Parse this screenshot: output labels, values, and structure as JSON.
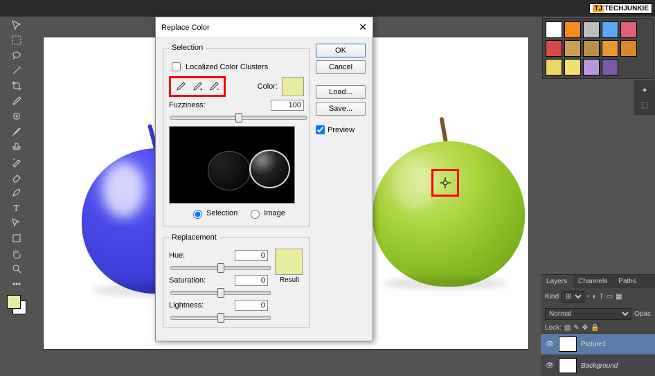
{
  "brand": {
    "name1": "TJ",
    "name2": "TECHJUNKIE"
  },
  "dialog": {
    "title": "Replace Color",
    "selection_legend": "Selection",
    "localized_label": "Localized Color Clusters",
    "color_label": "Color:",
    "color_swatch": "#e8ec9f",
    "fuzziness_label": "Fuzziness:",
    "fuzziness_value": "100",
    "radio_selection": "Selection",
    "radio_image": "Image",
    "replacement_legend": "Replacement",
    "hue_label": "Hue:",
    "hue_value": "0",
    "sat_label": "Saturation:",
    "sat_value": "0",
    "light_label": "Lightness:",
    "light_value": "0",
    "result_label": "Result",
    "result_swatch": "#e8ec9f",
    "buttons": {
      "ok": "OK",
      "cancel": "Cancel",
      "load": "Load...",
      "save": "Save...",
      "preview": "Preview"
    }
  },
  "panels": {
    "layers_tab": "Layers",
    "channels_tab": "Channels",
    "paths_tab": "Paths",
    "kind": "Kind",
    "blend_mode": "Normal",
    "opac_label": "Opac",
    "lock_label": "Lock:",
    "layer1": "Picture1",
    "layer2": "Background"
  },
  "swatches": [
    "#ffffff",
    "#f28c1a",
    "#bdbdbd",
    "#5aa8f0",
    "#e0607a",
    "#d84848",
    "#c8a050",
    "#b89048",
    "#e89830",
    "#d88828",
    "#ead862",
    "#f0e070",
    "#b898d8",
    "#7a5aa8"
  ]
}
